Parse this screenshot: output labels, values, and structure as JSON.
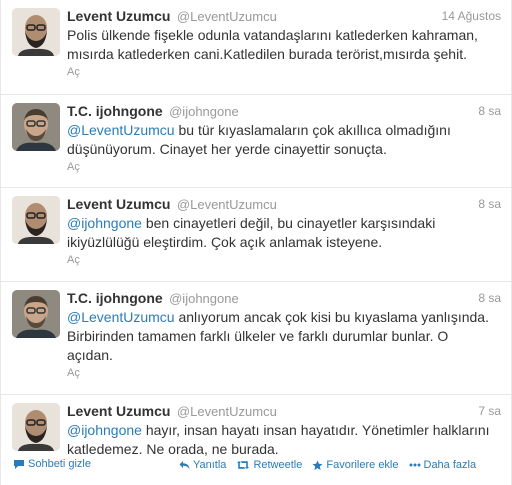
{
  "tweets": [
    {
      "fullname": "Levent Uzumcu",
      "username": "@LeventUzumcu",
      "time": "14 Ağustos",
      "mention": "",
      "text": "Polis ülkende fişekle odunla vatandaşlarını katlederken kahraman, mısırda katlederken cani.Katledilen burada terörist,mısırda şehit.",
      "expand": "Aç",
      "avatar": "avatar-levent"
    },
    {
      "fullname": "T.C. ijohngone",
      "username": "@ijohngone",
      "time": "8 sa",
      "mention": "@LeventUzumcu",
      "text": " bu tür kıyaslamaların çok akıllıca olmadığını düşünüyorum. Cinayet her yerde cinayettir sonuçta.",
      "expand": "Aç",
      "avatar": "avatar-ijohngone"
    },
    {
      "fullname": "Levent Uzumcu",
      "username": "@LeventUzumcu",
      "time": "8 sa",
      "mention": "@ijohngone",
      "text": " ben cinayetleri değil, bu cinayetler karşısındaki ikiyüzlülüğü eleştirdim. Çok açık anlamak isteyene.",
      "expand": "Aç",
      "avatar": "avatar-levent"
    },
    {
      "fullname": "T.C. ijohngone",
      "username": "@ijohngone",
      "time": "8 sa",
      "mention": "@LeventUzumcu",
      "text": " anlıyorum ancak çok kisi bu kıyaslama yanlışında. Birbirinden tamamen farklı ülkeler ve farklı durumlar bunlar. O açıdan.",
      "expand": "Aç",
      "avatar": "avatar-ijohngone"
    },
    {
      "fullname": "Levent Uzumcu",
      "username": "@LeventUzumcu",
      "time": "7 sa",
      "mention": "@ijohngone",
      "text": " hayır, insan hayatı insan hayatıdır. Yönetimler halklarını katledemez. Ne orada, ne burada.",
      "avatar": "avatar-levent",
      "conversation_label": "Sohbeti gizle",
      "actions": {
        "reply": "Yanıtla",
        "retweet": "Retweetle",
        "favorite": "Favorilere ekle",
        "more": "Daha fazla"
      }
    }
  ],
  "colors": {
    "link": "#2a7cb8",
    "muted": "#999999",
    "text": "#333333",
    "border": "#e8e8e8"
  },
  "icons": {
    "conversation": "conversation-icon",
    "reply": "reply-icon",
    "retweet": "retweet-icon",
    "favorite": "star-icon",
    "more": "more-dots-icon"
  }
}
